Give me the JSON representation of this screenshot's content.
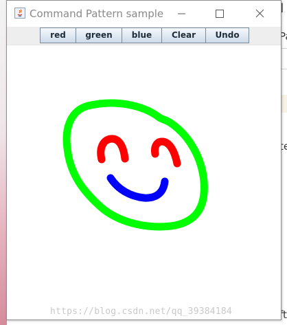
{
  "window": {
    "title": "Command Pattern sample"
  },
  "toolbar": {
    "buttons": [
      {
        "label": "red"
      },
      {
        "label": "green"
      },
      {
        "label": "blue"
      },
      {
        "label": "Clear"
      },
      {
        "label": "Undo"
      }
    ]
  },
  "canvas": {
    "strokes": [
      {
        "color": "#00ff00",
        "name": "face-outline"
      },
      {
        "color": "#ff0000",
        "name": "left-eye"
      },
      {
        "color": "#ff0000",
        "name": "right-eye"
      },
      {
        "color": "#0000ff",
        "name": "mouth"
      }
    ]
  },
  "background": {
    "right_fragments": [
      "Pa",
      "]",
      "te",
      "ft"
    ],
    "watermark": "https://blog.csdn.net/qq_39384184"
  },
  "colors": {
    "button_text": "#1f2d3a",
    "title_text": "#8a8a8a"
  },
  "icons": {
    "app": "java-app-icon",
    "minimize": "minimize-icon",
    "maximize": "maximize-icon",
    "close": "close-icon"
  }
}
